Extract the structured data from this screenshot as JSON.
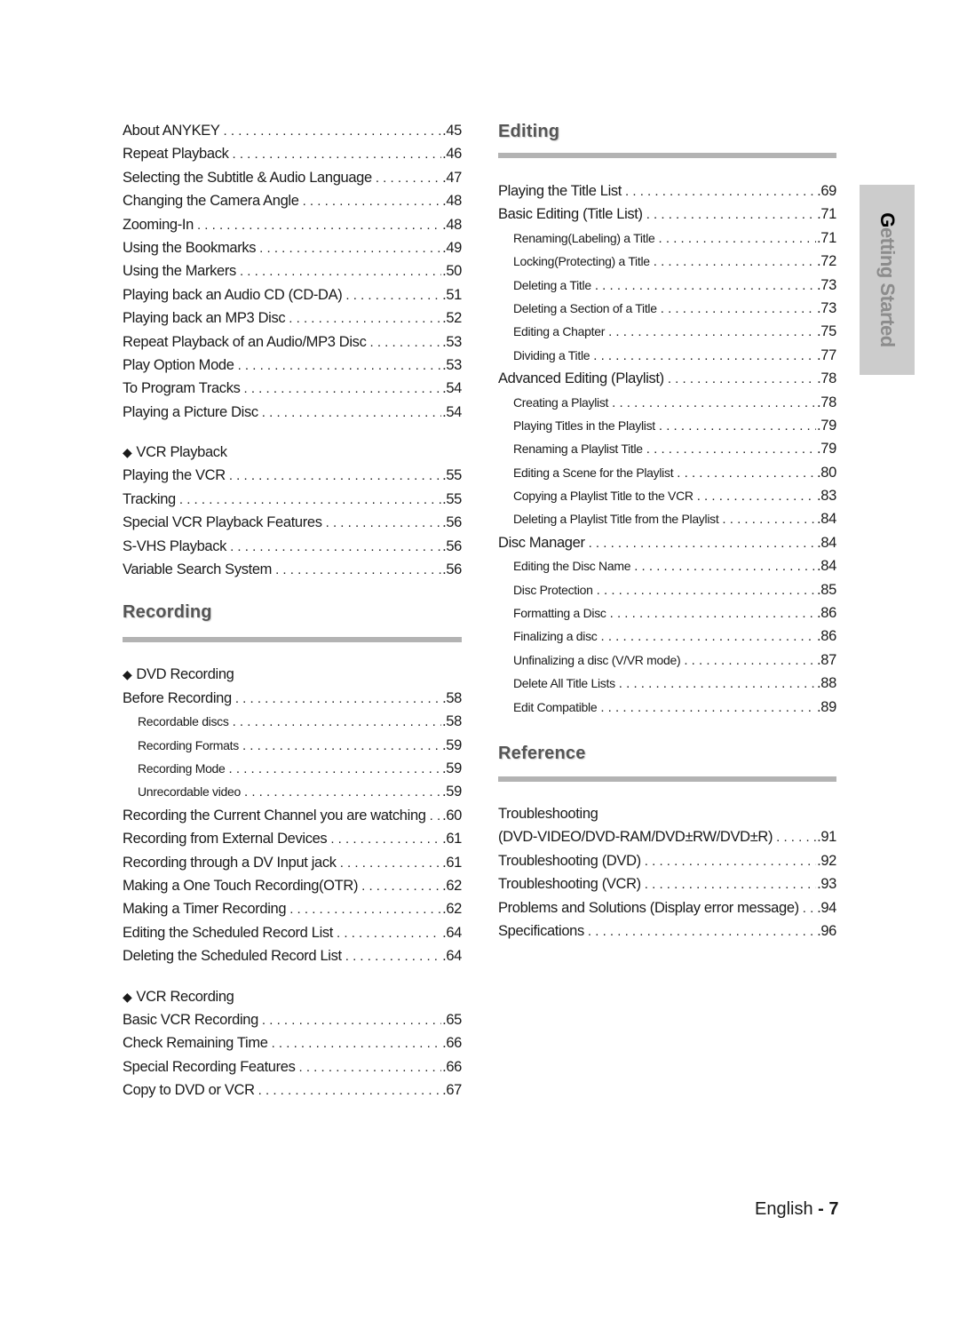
{
  "left_column": {
    "intro_items": [
      {
        "label": "About ANYKEY",
        "page": ".45"
      },
      {
        "label": "Repeat Playback",
        "page": ".46"
      },
      {
        "label": "Selecting the Subtitle & Audio Language",
        "page": ".47"
      },
      {
        "label": "Changing the Camera Angle",
        "page": ".48"
      },
      {
        "label": "Zooming-In",
        "page": ".48"
      },
      {
        "label": "Using the Bookmarks",
        "page": ".49"
      },
      {
        "label": "Using the Markers",
        "page": ".50"
      },
      {
        "label": "Playing back an Audio CD (CD-DA)",
        "page": ".51"
      },
      {
        "label": "Playing back an MP3 Disc",
        "page": ".52"
      },
      {
        "label": "Repeat Playback of an Audio/MP3 Disc",
        "page": ".53"
      },
      {
        "label": "Play Option Mode",
        "page": ".53"
      },
      {
        "label": "To Program Tracks",
        "page": ".54"
      },
      {
        "label": "Playing a Picture Disc",
        "page": ".54"
      }
    ],
    "vcr_playback": {
      "title": "VCR Playback",
      "bullet": "◆",
      "items": [
        {
          "label": "Playing the VCR",
          "page": ".55"
        },
        {
          "label": "Tracking",
          "page": ".55"
        },
        {
          "label": "Special VCR Playback Features",
          "page": ".56"
        },
        {
          "label": "S-VHS Playback",
          "page": ".56"
        },
        {
          "label": "Variable Search System",
          "page": ".56"
        }
      ]
    },
    "recording": {
      "heading": "Recording",
      "dvd_recording": {
        "title": "DVD Recording",
        "bullet": "◆",
        "items": [
          {
            "label": "Before Recording",
            "page": ".58",
            "sub": false
          },
          {
            "label": "Recordable discs",
            "page": ".58",
            "sub": true
          },
          {
            "label": "Recording Formats",
            "page": ".59",
            "sub": true
          },
          {
            "label": "Recording Mode",
            "page": ".59",
            "sub": true
          },
          {
            "label": "Unrecordable video",
            "page": ".59",
            "sub": true
          },
          {
            "label": "Recording the Current Channel you are watching",
            "page": ".60",
            "sub": false
          },
          {
            "label": "Recording from External Devices",
            "page": ".61",
            "sub": false
          },
          {
            "label": "Recording through a DV Input jack",
            "page": ".61",
            "sub": false
          },
          {
            "label": "Making a One Touch Recording(OTR)",
            "page": ".62",
            "sub": false
          },
          {
            "label": "Making a Timer Recording",
            "page": ".62",
            "sub": false
          },
          {
            "label": "Editing the Scheduled Record List",
            "page": ".64",
            "sub": false
          },
          {
            "label": "Deleting the Scheduled Record List",
            "page": ".64",
            "sub": false
          }
        ]
      },
      "vcr_recording": {
        "title": "VCR Recording",
        "bullet": "◆",
        "items": [
          {
            "label": "Basic VCR Recording",
            "page": ".65"
          },
          {
            "label": "Check Remaining Time",
            "page": ".66"
          },
          {
            "label": "Special Recording Features",
            "page": ".66"
          },
          {
            "label": "Copy to DVD or VCR",
            "page": ".67"
          }
        ]
      }
    }
  },
  "right_column": {
    "editing": {
      "heading": "Editing",
      "items": [
        {
          "label": "Playing the Title List",
          "page": ".69",
          "sub": false
        },
        {
          "label": "Basic Editing (Title List)",
          "page": ".71",
          "sub": false
        },
        {
          "label": "Renaming(Labeling) a Title",
          "page": ".71",
          "sub": true
        },
        {
          "label": "Locking(Protecting) a Title",
          "page": ".72",
          "sub": true
        },
        {
          "label": "Deleting a Title",
          "page": ".73",
          "sub": true
        },
        {
          "label": "Deleting a Section of a Title",
          "page": ".73",
          "sub": true
        },
        {
          "label": "Editing a Chapter",
          "page": ".75",
          "sub": true
        },
        {
          "label": "Dividing a Title",
          "page": ".77",
          "sub": true
        },
        {
          "label": "Advanced Editing (Playlist)",
          "page": ".78",
          "sub": false
        },
        {
          "label": "Creating a Playlist",
          "page": ".78",
          "sub": true
        },
        {
          "label": "Playing Titles in the Playlist",
          "page": ".79",
          "sub": true
        },
        {
          "label": "Renaming a Playlist Title",
          "page": ".79",
          "sub": true
        },
        {
          "label": "Editing a Scene for the Playlist",
          "page": ".80",
          "sub": true
        },
        {
          "label": "Copying a Playlist Title to the VCR",
          "page": ".83",
          "sub": true
        },
        {
          "label": "Deleting a Playlist Title from the Playlist",
          "page": ".84",
          "sub": true
        },
        {
          "label": "Disc Manager",
          "page": ".84",
          "sub": false
        },
        {
          "label": "Editing the Disc Name",
          "page": ".84",
          "sub": true
        },
        {
          "label": "Disc Protection",
          "page": ".85",
          "sub": true
        },
        {
          "label": "Formatting a Disc",
          "page": ".86",
          "sub": true
        },
        {
          "label": "Finalizing a disc",
          "page": ".86",
          "sub": true
        },
        {
          "label": "Unfinalizing a disc (V/VR mode)",
          "page": ".87",
          "sub": true
        },
        {
          "label": "Delete All Title Lists",
          "page": ".88",
          "sub": true
        },
        {
          "label": "Edit Compatible",
          "page": ".89",
          "sub": true
        }
      ]
    },
    "reference": {
      "heading": "Reference",
      "troubleshooting_line1": "Troubleshooting",
      "items": [
        {
          "label": "(DVD-VIDEO/DVD-RAM/DVD±RW/DVD±R)",
          "page": ".91"
        },
        {
          "label": "Troubleshooting (DVD)",
          "page": ".92"
        },
        {
          "label": "Troubleshooting (VCR)",
          "page": ".93"
        },
        {
          "label": "Problems and Solutions (Display error message)",
          "page": ".94"
        },
        {
          "label": "Specifications",
          "page": ".96"
        }
      ]
    }
  },
  "side_tab": {
    "first_letter": "G",
    "rest": "etting Started"
  },
  "footer": {
    "language": "English",
    "separator": " - ",
    "page_number": "7"
  },
  "colors": {
    "heading": "#555555",
    "bar": "#b3b3b3",
    "side_tab_bg": "#cccccc",
    "side_tab_text": "#8c8c8c"
  }
}
